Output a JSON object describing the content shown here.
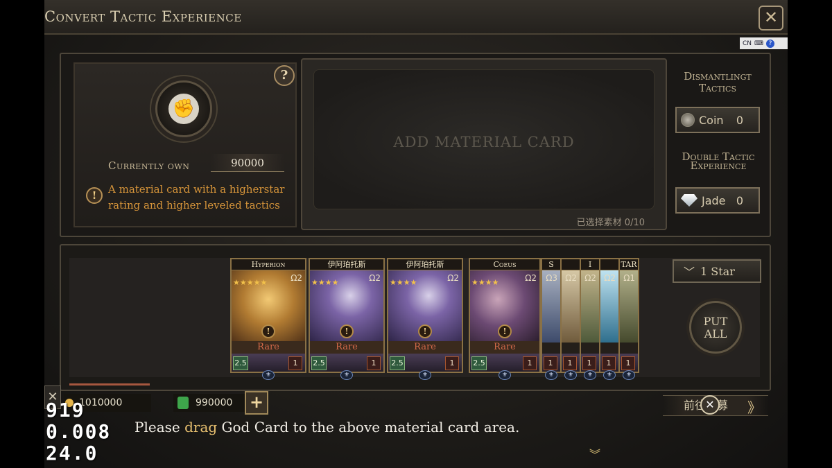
{
  "window": {
    "title": "Convert Tactic Experience",
    "close_symbol": "✕"
  },
  "ime": {
    "mode": "CN",
    "help": "?"
  },
  "left_panel": {
    "help": "?",
    "emblem_glyph": "✊",
    "own_label": "Currently own",
    "own_value": "90000",
    "warn_symbol": "!",
    "warn_text": "A material card with a higherstar rating and higher leveled tactics"
  },
  "material": {
    "label": "ADD MATERIAL CARD",
    "selected": "已选择素材  0/10"
  },
  "dismantle": {
    "title": "Dismantlingt Tactics",
    "coin_label": "Coin",
    "coin_value": "0",
    "double_title": "Double Tactic Experience",
    "jade_label": "Jade",
    "jade_value": "0"
  },
  "cards": [
    {
      "name": "Hyperion",
      "art": "hyperion",
      "omega": "Ω2",
      "rarity": "Rare",
      "power": "2.5",
      "level": "1",
      "stars": 5
    },
    {
      "name": "伊阿珀托斯",
      "art": "purple",
      "omega": "Ω2",
      "rarity": "Rare",
      "power": "2.5",
      "level": "1",
      "stars": 4
    },
    {
      "name": "伊阿珀托斯",
      "art": "purple",
      "omega": "Ω2",
      "rarity": "Rare",
      "power": "2.5",
      "level": "1",
      "stars": 4
    },
    {
      "name": "Coeus",
      "art": "coeus",
      "omega": "Ω2",
      "rarity": "Rare",
      "power": "2.5",
      "level": "1",
      "stars": 4
    },
    {
      "name": "S",
      "art": "small1",
      "omega": "Ω3",
      "level": "1"
    },
    {
      "name": "",
      "art": "small2",
      "omega": "Ω2",
      "level": "1"
    },
    {
      "name": "I",
      "art": "small3",
      "omega": "Ω2",
      "level": "1"
    },
    {
      "name": "",
      "art": "small4",
      "omega": "Ω2",
      "level": "1"
    },
    {
      "name": "TAR",
      "art": "small5",
      "omega": "Ω1",
      "level": "1"
    }
  ],
  "filter": {
    "arrow": "﹀",
    "label": "1  Star"
  },
  "put_all": {
    "line1": "PUT",
    "line2": "ALL"
  },
  "resources": {
    "close": "✕",
    "gold": "1010000",
    "gems": "990000",
    "plus": "+",
    "recruit_label": "前往招募",
    "recruit_close": "✕",
    "recruit_arrow": "》"
  },
  "hint": {
    "before": "Please ",
    "highlight": "drag",
    "after": " God Card to the above material card area."
  },
  "overlay": {
    "line1": "919",
    "line2": "0.008",
    "line3": "24.0"
  },
  "colors": {
    "accent": "#d7953a",
    "rarity": "#d46a4a",
    "highlight": "#e9c170"
  }
}
